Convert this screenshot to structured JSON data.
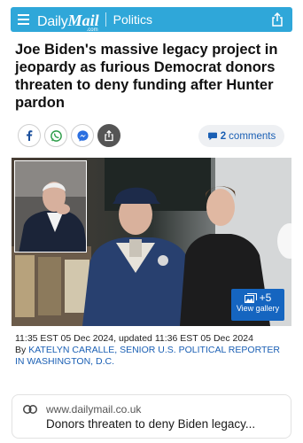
{
  "header": {
    "logo_daily": "Daily",
    "logo_mail": "Mail",
    "logo_com": ".com",
    "section": "Politics",
    "bar_color": "#2fa7d9"
  },
  "article": {
    "headline": "Joe Biden's massive legacy project in jeopardy as furious Democrat donors threaten to deny funding after Hunter pardon",
    "timestamp": "11:35 EST 05 Dec 2024, updated 11:36 EST 05 Dec 2024",
    "byline_prefix": "By",
    "byline": "KATELYN CARALLE, SENIOR U.S. POLITICAL REPORTER IN WASHINGTON, D.C."
  },
  "share": {
    "icons": [
      "facebook-icon",
      "whatsapp-icon",
      "messenger-icon",
      "share-icon"
    ]
  },
  "comments": {
    "count": "2",
    "label": "comments"
  },
  "gallery": {
    "count": "+5",
    "label": "View gallery"
  },
  "link_preview": {
    "domain": "www.dailymail.co.uk",
    "title": "Donors threaten to deny Biden legacy..."
  }
}
